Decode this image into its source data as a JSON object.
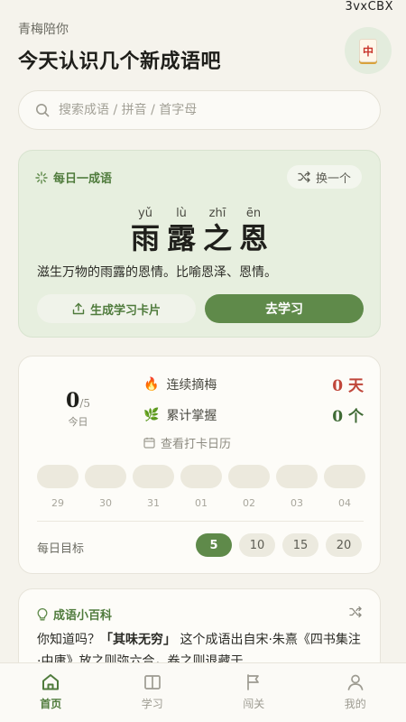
{
  "watermark": "3vxCBX",
  "header": {
    "subtitle": "青梅陪你",
    "title": "今天认识几个新成语吧",
    "avatar_icon": "mahjong-tile-icon",
    "avatar_glyph": "中"
  },
  "search": {
    "placeholder": "搜索成语 / 拼音 / 首字母"
  },
  "daily": {
    "label": "每日一成语",
    "swap_label": "换一个",
    "idiom": [
      {
        "char": "雨",
        "pinyin": "yǔ"
      },
      {
        "char": "露",
        "pinyin": "lù"
      },
      {
        "char": "之",
        "pinyin": "zhī"
      },
      {
        "char": "恩",
        "pinyin": "ēn"
      }
    ],
    "meaning": "滋生万物的雨露的恩情。比喻恩泽、恩情。",
    "card_button": "生成学习卡片",
    "learn_button": "去学习"
  },
  "stats": {
    "today_count": "0",
    "today_total": "/5",
    "today_label": "今日",
    "streak_icon": "🔥",
    "streak_label": "连续摘梅",
    "streak_value": "0 天",
    "mastered_icon": "🌿",
    "mastered_label": "累计掌握",
    "mastered_value": "0 个",
    "calendar_link": "查看打卡日历",
    "days": [
      "29",
      "30",
      "31",
      "01",
      "02",
      "03",
      "04"
    ],
    "goal_label": "每日目标",
    "goal_options": [
      "5",
      "10",
      "15",
      "20"
    ],
    "goal_selected": "5"
  },
  "wiki": {
    "label": "成语小百科",
    "intro": "你知道吗？",
    "highlight": "「其味无穷」",
    "text": " 这个成语出自宋·朱熹《四书集注·中庸》放之则弥六合，卷之则退藏于"
  },
  "tabs": [
    {
      "label": "首页",
      "icon": "home-icon",
      "active": true
    },
    {
      "label": "学习",
      "icon": "book-icon",
      "active": false
    },
    {
      "label": "闯关",
      "icon": "flag-icon",
      "active": false
    },
    {
      "label": "我的",
      "icon": "user-icon",
      "active": false
    }
  ],
  "colors": {
    "accent": "#5f8a4a",
    "accent_text": "#4f7b3c",
    "streak": "#c0463a",
    "background": "#f5f3ec"
  }
}
